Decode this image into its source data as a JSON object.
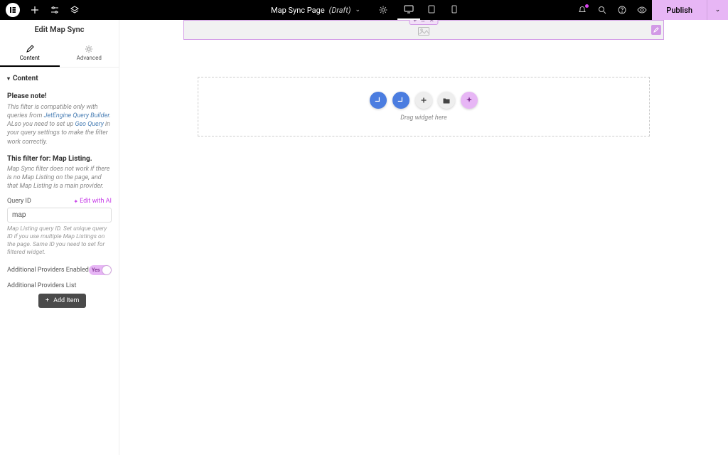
{
  "topbar": {
    "page_name": "Map Sync Page",
    "draft_label": "(Draft)",
    "publish_label": "Publish"
  },
  "sidebar": {
    "title": "Edit Map Sync",
    "tabs": {
      "content": "Content",
      "advanced": "Advanced"
    },
    "section_header": "Content",
    "note_title": "Please note!",
    "note_prefix": "This filter is compatible only with queries from ",
    "note_link1": "JetEngine Query Builder",
    "note_mid": ". ALso you need to set up ",
    "note_link2": "Geo Query",
    "note_suffix": " in your query settings to make the filter work correctly.",
    "filter_for_title": "This filter for: Map Listing.",
    "filter_for_note": "Map Sync filter does not work if there is no Map Listing on the page, and that Map Listing is a main provider.",
    "query_id_label": "Query ID",
    "edit_ai_label": "Edit with AI",
    "query_id_value": "map",
    "query_id_help": "Map Listing query ID. Set unique query ID if you use multiple Map Listings on the page. Same ID you need to set for filtered widget.",
    "addl_providers_enabled_label": "Additional Providers Enabled",
    "toggle_yes": "Yes",
    "addl_providers_list_label": "Additional Providers List",
    "add_item_label": "Add Item"
  },
  "canvas": {
    "drag_label": "Drag widget here"
  }
}
